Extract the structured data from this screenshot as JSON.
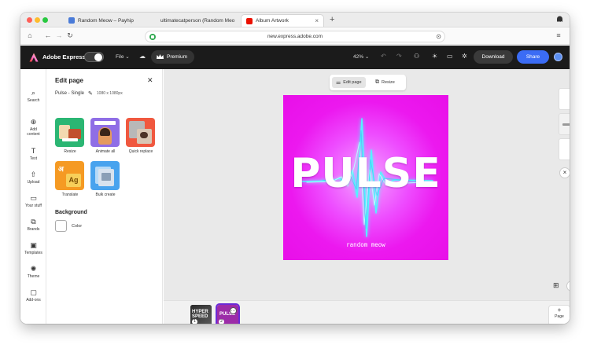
{
  "browser": {
    "tabs": [
      {
        "title": "Random Meow – Payhip",
        "active": false
      },
      {
        "title": "ultimatecatperson (Random Meo",
        "active": false
      },
      {
        "title": "Album Artwork",
        "active": true
      }
    ],
    "url": "new.express.adobe.com",
    "traffic_colors": [
      "#ff5f57",
      "#febc2e",
      "#28c840"
    ]
  },
  "header": {
    "brand": "Adobe Express",
    "file_label": "File",
    "premium_label": "Premium",
    "zoom": "42%",
    "download_label": "Download",
    "share_label": "Share",
    "accent": "#3b6cf5"
  },
  "rail": {
    "items": [
      {
        "icon": "search-icon",
        "label": "Search"
      },
      {
        "icon": "add-icon",
        "label": "Add content"
      },
      {
        "icon": "text-icon",
        "label": "Text"
      },
      {
        "icon": "upload-icon",
        "label": "Upload"
      },
      {
        "icon": "folder-icon",
        "label": "Your stuff"
      },
      {
        "icon": "brands-icon",
        "label": "Brands"
      },
      {
        "icon": "templates-icon",
        "label": "Templates"
      },
      {
        "icon": "theme-icon",
        "label": "Theme"
      },
      {
        "icon": "addons-icon",
        "label": "Add-ons"
      }
    ]
  },
  "panel": {
    "title": "Edit page",
    "page_name": "Pulse - Single",
    "page_size": "1080 x 1080px",
    "tools": [
      {
        "label": "Resize"
      },
      {
        "label": "Animate all"
      },
      {
        "label": "Quick replace"
      },
      {
        "label": "Translate"
      },
      {
        "label": "Bulk create"
      }
    ],
    "background_title": "Background",
    "color_label": "Color"
  },
  "canvas": {
    "toolbar": {
      "edit_page": "Edit page",
      "resize": "Resize"
    },
    "artwork": {
      "title": "PULSE",
      "subtitle": "random meow"
    },
    "artwork_color": "#ec18ef"
  },
  "filmstrip": {
    "thumbs": [
      {
        "text": "HYPER SPEED",
        "badge": "1"
      },
      {
        "text": "PULSE",
        "badge": "2"
      }
    ],
    "add_page_label": "Page"
  }
}
